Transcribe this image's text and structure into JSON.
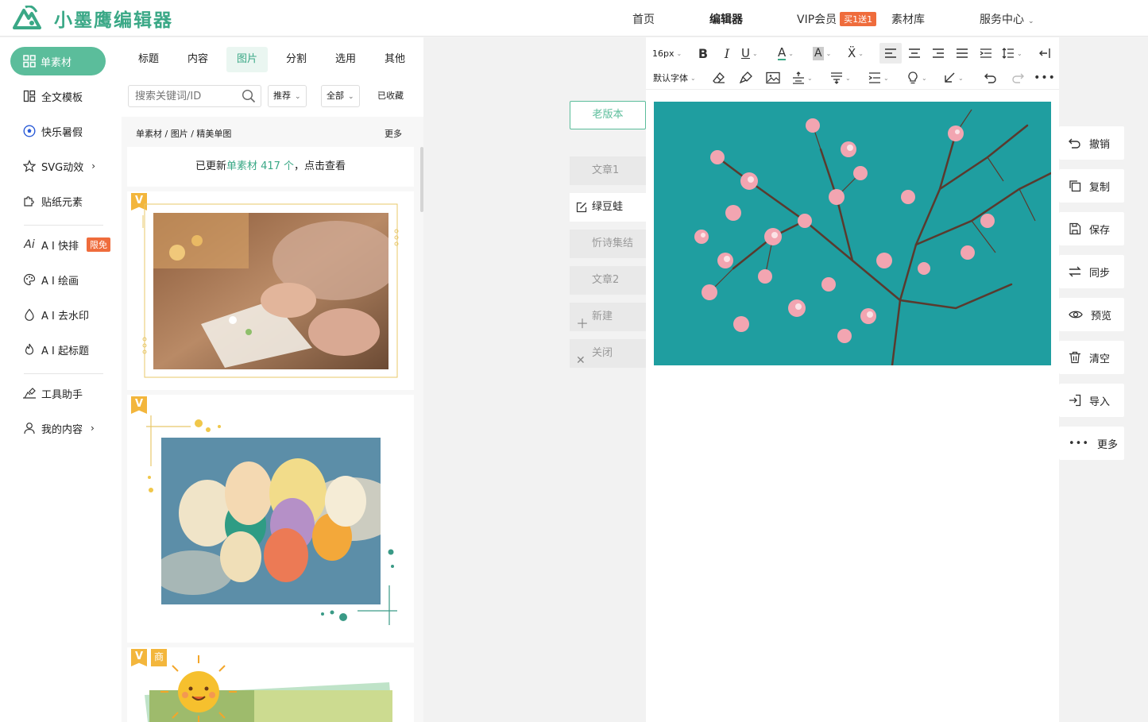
{
  "brand": {
    "name": "小墨鹰编辑器",
    "color": "#3aa886"
  },
  "nav": {
    "items": [
      "首页",
      "编辑器",
      "VIP会员",
      "素材库",
      "服务中心"
    ],
    "vip_badge": "买1送1"
  },
  "sidebar": {
    "active": "单素材",
    "items": [
      "全文模板",
      "快乐暑假",
      "SVG动效",
      "贴纸元素",
      "A I 快排",
      "A I 绘画",
      "A I 去水印",
      "A I 起标题",
      "工具助手",
      "我的内容"
    ],
    "ai_badge": "限免"
  },
  "panel": {
    "tabs": [
      "标题",
      "内容",
      "图片",
      "分割",
      "选用",
      "其他"
    ],
    "active_tab": "图片",
    "search_placeholder": "搜索关键词/ID",
    "filter_sort": "推荐",
    "filter_range": "全部",
    "collected": "已收藏",
    "breadcrumb": "单素材 / 图片 / 精美单图",
    "more": "更多",
    "update": {
      "prefix": "已更新",
      "highlight": "单素材 417 个",
      "suffix": "，点击查看"
    },
    "card_tags": {
      "v": "V",
      "shang": "商"
    }
  },
  "articles": {
    "old_version": "老版本",
    "items": [
      "文章1",
      "绿豆蛙",
      "忻诗集结",
      "文章2"
    ],
    "active": "绿豆蛙",
    "new_label": "新建",
    "close_label": "关闭"
  },
  "toolbar": {
    "font_size": "16px",
    "font_family": "默认字体"
  },
  "actions": [
    "撤销",
    "复制",
    "保存",
    "同步",
    "预览",
    "清空",
    "导入",
    "更多"
  ],
  "colors": {
    "accent": "#5bbd9b",
    "badge": "#ef6c3c",
    "tag": "#f3b63c"
  }
}
